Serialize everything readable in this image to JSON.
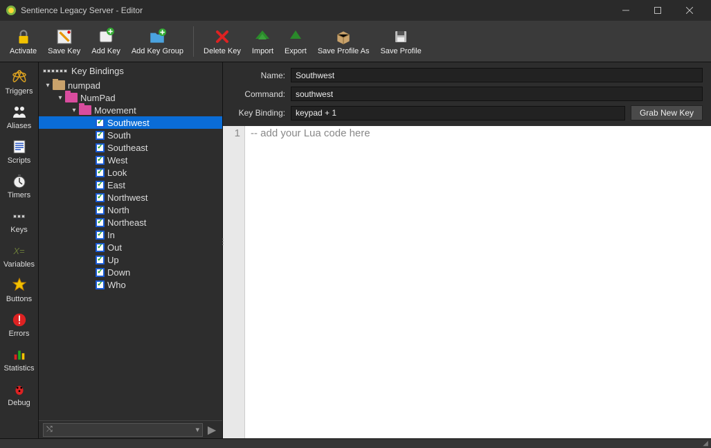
{
  "window": {
    "title": "Sentience Legacy Server - Editor"
  },
  "toolbar": {
    "activate": "Activate",
    "saveKey": "Save Key",
    "addKey": "Add Key",
    "addKeyGroup": "Add Key Group",
    "deleteKey": "Delete Key",
    "import": "Import",
    "export": "Export",
    "saveProfileAs": "Save Profile As",
    "saveProfile": "Save Profile"
  },
  "sidetabs": {
    "triggers": "Triggers",
    "aliases": "Aliases",
    "scripts": "Scripts",
    "timers": "Timers",
    "keys": "Keys",
    "variables": "Variables",
    "buttons": "Buttons",
    "errors": "Errors",
    "statistics": "Statistics",
    "debug": "Debug"
  },
  "tree": {
    "header": "Key Bindings",
    "root": {
      "label": "numpad",
      "expanded": true
    },
    "group": {
      "label": "NumPad",
      "expanded": true
    },
    "subgroup": {
      "label": "Movement",
      "expanded": true
    },
    "items": [
      "Southwest",
      "South",
      "Southeast",
      "West",
      "Look",
      "East",
      "Northwest",
      "North",
      "Northeast",
      "In",
      "Out",
      "Up",
      "Down",
      "Who"
    ],
    "selected": "Southwest"
  },
  "treeFooter": {
    "comboIcon": "⤭",
    "dropChevron": "▾",
    "play": "▶"
  },
  "fields": {
    "nameLabel": "Name:",
    "nameValue": "Southwest",
    "commandLabel": "Command:",
    "commandValue": "southwest",
    "bindingLabel": "Key Binding:",
    "bindingValue": "keypad + 1",
    "grabBtn": "Grab New Key"
  },
  "editor": {
    "lineNumber": "1",
    "content": "-- add your Lua code here"
  }
}
